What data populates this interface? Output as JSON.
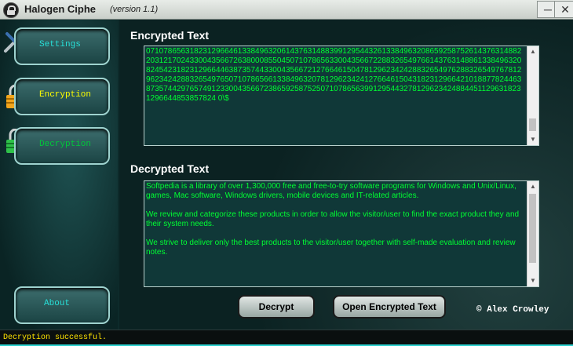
{
  "window": {
    "title": "Halogen Ciphe",
    "version": "(version 1.1)",
    "minimize_label": "─",
    "close_label": "✕"
  },
  "sidebar": {
    "settings_label": "Settings",
    "encryption_label": "Encryption",
    "decryption_label": "Decryption",
    "about_label": "About"
  },
  "encrypted": {
    "title": "Encrypted Text",
    "text": "07107865631823129664613384963206143763148839912954432613384963208659258752614376314882203121702433004356672638000855045071078656330043566722883265497661437631488613384963208245423182312966446387357443300435667212766461504781296234242883265497628832654976781296234242883265497650710786566133849632078129623424127664615043182312966421018877824463873574429765749123300435667238659258752507107865639912954432781296234248844511296318231296644853857824 0\\$"
  },
  "decrypted": {
    "title": "Decrypted Text",
    "text": "Softpedia is a library of over 1,300,000 free and free-to-try software programs for Windows and Unix/Linux, games, Mac software, Windows drivers, mobile devices and IT-related articles.\n\nWe review and categorize these products in order to allow the visitor/user to find the exact product they and their system needs.\n\nWe strive to deliver only the best products to the visitor/user together with self-made evaluation and review notes."
  },
  "actions": {
    "decrypt_label": "Decrypt",
    "open_label": "Open Encrypted Text"
  },
  "copyright": "© Alex Crowley",
  "status": {
    "text": "Decryption successful."
  },
  "icons": {
    "app": "lock-icon",
    "settings": "tools-icon",
    "encryption": "locked-padlock-icon",
    "decryption": "unlocked-padlock-icon"
  },
  "colors": {
    "accent": "#2bd1cf",
    "text_green": "#00ff33",
    "status_yellow": "#ffe400",
    "sidebar_label_yellow": "#ffff00",
    "sidebar_label_cyan": "#27e0d8"
  }
}
